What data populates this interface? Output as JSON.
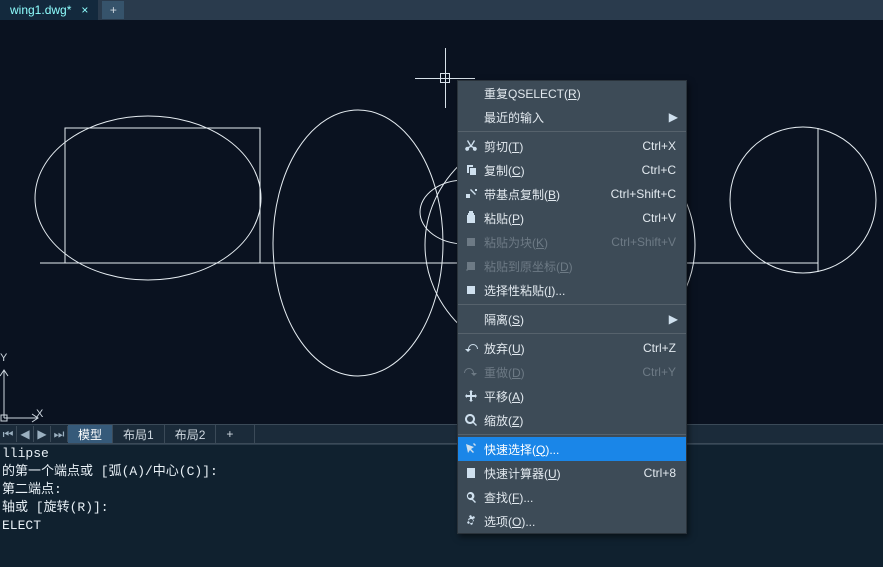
{
  "file_tab": {
    "name": "wing1.dwg*",
    "close_glyph": "×"
  },
  "plus_glyph": "+",
  "ucs_labels": {
    "x": "X",
    "y": "Y"
  },
  "layout_tabs": {
    "nav": {
      "first": "⏮",
      "prev": "◀",
      "next": "▶",
      "last": "⏭"
    },
    "items": [
      "模型",
      "布局1",
      "布局2"
    ],
    "active_index": 0,
    "plus": "+"
  },
  "command_lines": [
    "llipse",
    "的第一个端点或 [弧(A)/中心(C)]:",
    "第二端点:",
    "轴或 [旋转(R)]:",
    "ELECT"
  ],
  "context_menu": {
    "groups": [
      [
        {
          "icon": "",
          "label": "重复QSELECT(R)",
          "u": "R",
          "enabled": true
        },
        {
          "icon": "",
          "label": "最近的输入",
          "u": "",
          "enabled": true,
          "submenu": true
        }
      ],
      [
        {
          "icon": "cut",
          "label": "剪切(T)",
          "u": "T",
          "shortcut": "Ctrl+X",
          "enabled": true
        },
        {
          "icon": "copy",
          "label": "复制(C)",
          "u": "C",
          "shortcut": "Ctrl+C",
          "enabled": true
        },
        {
          "icon": "copybase",
          "label": "带基点复制(B)",
          "u": "B",
          "shortcut": "Ctrl+Shift+C",
          "enabled": true
        },
        {
          "icon": "paste",
          "label": "粘贴(P)",
          "u": "P",
          "shortcut": "Ctrl+V",
          "enabled": true
        },
        {
          "icon": "pasteblock",
          "label": "粘贴为块(K)",
          "u": "K",
          "shortcut": "Ctrl+Shift+V",
          "enabled": false
        },
        {
          "icon": "pasteorig",
          "label": "粘贴到原坐标(D)",
          "u": "D",
          "shortcut": "",
          "enabled": false
        },
        {
          "icon": "pastespec",
          "label": "选择性粘贴(I)...",
          "u": "I",
          "shortcut": "",
          "enabled": true
        }
      ],
      [
        {
          "icon": "",
          "label": "隔离(S)",
          "u": "S",
          "enabled": true,
          "submenu": true
        }
      ],
      [
        {
          "icon": "undo",
          "label": "放弃(U)",
          "u": "U",
          "shortcut": "Ctrl+Z",
          "enabled": true
        },
        {
          "icon": "redo",
          "label": "重做(D)",
          "u": "D",
          "shortcut": "Ctrl+Y",
          "enabled": false
        },
        {
          "icon": "pan",
          "label": "平移(A)",
          "u": "A",
          "enabled": true
        },
        {
          "icon": "zoom",
          "label": "缩放(Z)",
          "u": "Z",
          "enabled": true
        }
      ],
      [
        {
          "icon": "qselect",
          "label": "快速选择(Q)...",
          "u": "Q",
          "enabled": true,
          "highlight": true
        },
        {
          "icon": "calc",
          "label": "快速计算器(U)",
          "u": "U",
          "shortcut": "Ctrl+8",
          "enabled": true
        },
        {
          "icon": "find",
          "label": "查找(F)...",
          "u": "F",
          "enabled": true
        },
        {
          "icon": "options",
          "label": "选项(O)...",
          "u": "O",
          "enabled": true
        }
      ]
    ]
  }
}
